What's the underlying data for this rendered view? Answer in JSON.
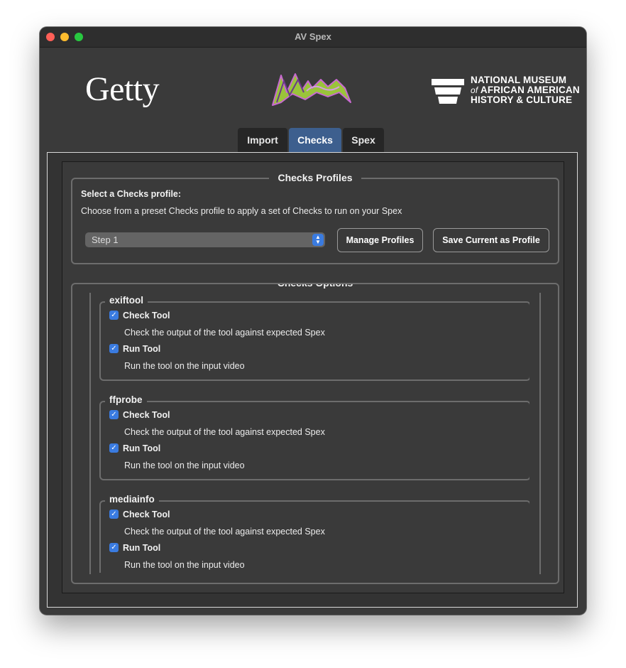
{
  "window": {
    "title": "AV Spex"
  },
  "logos": {
    "left": "Getty",
    "center": "AVSpex",
    "right_line1": "NATIONAL MUSEUM",
    "right_line2_of": "of",
    "right_line2": "AFRICAN AMERICAN",
    "right_line3": "HISTORY & CULTURE"
  },
  "tabs": [
    {
      "label": "Import",
      "active": false
    },
    {
      "label": "Checks",
      "active": true
    },
    {
      "label": "Spex",
      "active": false
    }
  ],
  "profiles": {
    "title": "Checks Profiles",
    "select_label": "Select a Checks profile:",
    "description": "Choose from a preset Checks profile to apply a set of Checks to run on your Spex",
    "selected_value": "Step 1",
    "manage_button": "Manage Profiles",
    "save_button": "Save Current as Profile"
  },
  "options": {
    "title": "Checks Options",
    "tools": [
      {
        "name": "exiftool",
        "check_label": "Check Tool",
        "check_checked": true,
        "check_desc": "Check the output of the tool against expected Spex",
        "run_label": "Run Tool",
        "run_checked": true,
        "run_desc": "Run the tool on the input video"
      },
      {
        "name": "ffprobe",
        "check_label": "Check Tool",
        "check_checked": true,
        "check_desc": "Check the output of the tool against expected Spex",
        "run_label": "Run Tool",
        "run_checked": true,
        "run_desc": "Run the tool on the input video"
      },
      {
        "name": "mediainfo",
        "check_label": "Check Tool",
        "check_checked": true,
        "check_desc": "Check the output of the tool against expected Spex",
        "run_label": "Run Tool",
        "run_checked": true,
        "run_desc": "Run the tool on the input video"
      }
    ]
  },
  "colors": {
    "accent": "#3a7be0",
    "active_tab": "#3d5f8e",
    "window_bg": "#3a3a3a"
  }
}
